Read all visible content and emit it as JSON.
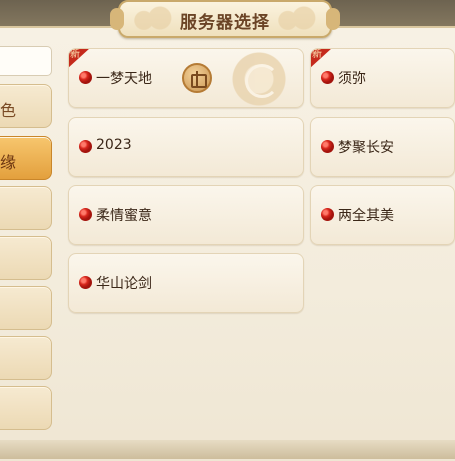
{
  "title": "服务器选择",
  "sidebar": {
    "tabs": [
      {
        "label": "色",
        "active": false
      },
      {
        "label": "缘",
        "active": true
      },
      {
        "label": "",
        "active": false
      },
      {
        "label": "",
        "active": false
      },
      {
        "label": "",
        "active": false
      },
      {
        "label": "",
        "active": false
      },
      {
        "label": "",
        "active": false
      }
    ]
  },
  "servers": [
    {
      "name": "一梦天地",
      "badge": "新",
      "status": "red"
    },
    {
      "name": "须弥",
      "badge": "新",
      "status": "red"
    },
    {
      "name": "2023",
      "status": "red"
    },
    {
      "name": "梦聚长安",
      "status": "red"
    },
    {
      "name": "柔情蜜意",
      "status": "red"
    },
    {
      "name": "两全其美",
      "status": "red"
    },
    {
      "name": "华山论剑",
      "status": "red"
    }
  ],
  "icons": {
    "gift": "gift-icon",
    "emblem": "swirl-emblem-icon",
    "status": "status-dot-icon"
  },
  "colors": {
    "accent_gold": "#e3a03d",
    "status_red": "#d8261c",
    "badge_red": "#c52a1c"
  }
}
